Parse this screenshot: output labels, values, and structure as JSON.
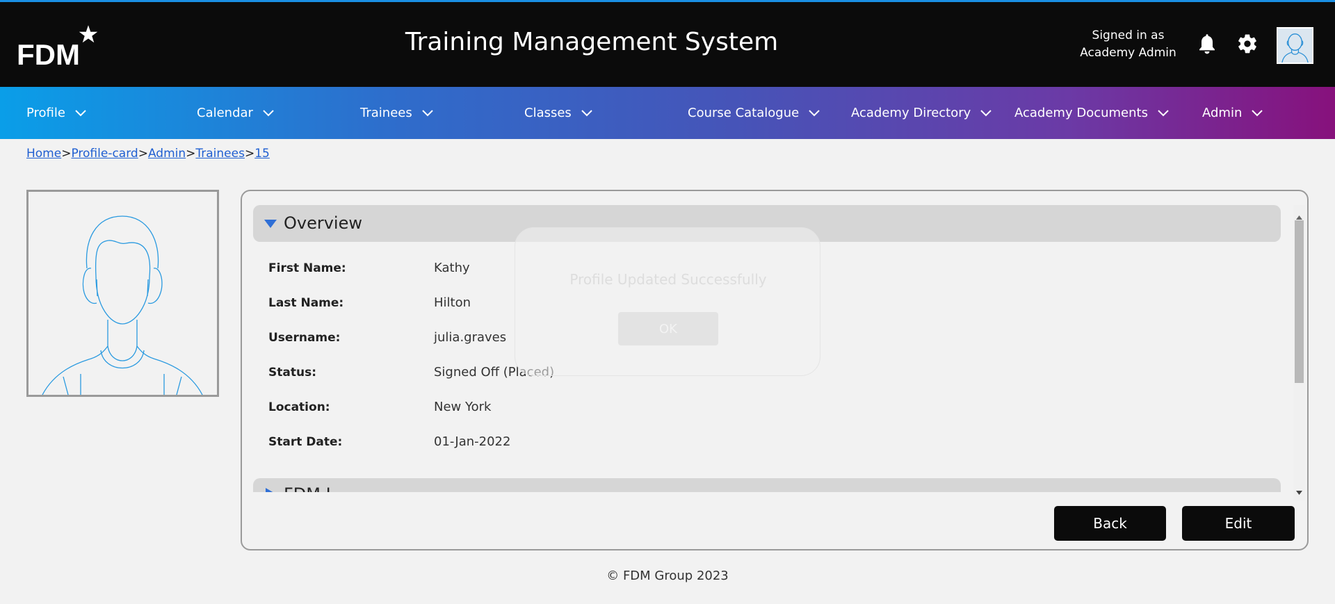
{
  "header": {
    "logo_text": "FDM",
    "title": "Training Management System",
    "signed_in_line1": "Signed in as",
    "signed_in_line2": "Academy Admin",
    "icons": [
      "bell-icon",
      "gear-icon",
      "avatar"
    ]
  },
  "nav": {
    "items": [
      {
        "label": "Profile"
      },
      {
        "label": "Calendar"
      },
      {
        "label": "Trainees"
      },
      {
        "label": "Classes"
      },
      {
        "label": "Course Catalogue"
      },
      {
        "label": "Academy Directory"
      },
      {
        "label": "Academy Documents"
      },
      {
        "label": "Admin"
      }
    ]
  },
  "breadcrumb": {
    "items": [
      "Home",
      "Profile-card",
      "Admin",
      "Trainees",
      "15"
    ],
    "separator": ">"
  },
  "overview": {
    "section_title": "Overview",
    "next_section_title": "FDM I",
    "fields": [
      {
        "label": "First Name:",
        "value": "Kathy"
      },
      {
        "label": "Last Name:",
        "value": "Hilton"
      },
      {
        "label": "Username:",
        "value": "julia.graves"
      },
      {
        "label": "Status:",
        "value": "Signed Off (Placed)"
      },
      {
        "label": "Location:",
        "value": "New York"
      },
      {
        "label": "Start Date:",
        "value": "01-Jan-2022"
      }
    ]
  },
  "actions": {
    "back_label": "Back",
    "edit_label": "Edit"
  },
  "modal": {
    "message": "Profile Updated Successfully",
    "ok_label": "OK"
  },
  "footer": {
    "text": "© FDM Group 2023"
  },
  "colors": {
    "header_bg": "#0b0b0b",
    "nav_gradient_start": "#0a9ee8",
    "nav_gradient_end": "#87117c",
    "link": "#1f5fd1",
    "button_bg": "#0b0b0b"
  }
}
